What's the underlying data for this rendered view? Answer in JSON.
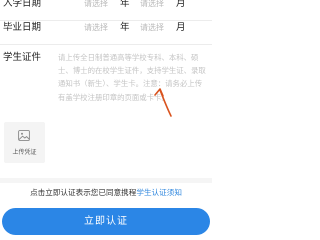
{
  "enroll_date": {
    "label": "入学日期",
    "year_placeholder": "请选择",
    "year_unit": "年",
    "month_placeholder": "请选择",
    "month_unit": "月"
  },
  "grad_date": {
    "label": "毕业日期",
    "year_placeholder": "请选择",
    "year_unit": "年",
    "month_placeholder": "请选择",
    "month_unit": "月"
  },
  "certificate": {
    "label": "学生证件",
    "hint": "请上传全日制普通高等学校专科、本科、硕士、博士的在校学生证件，支持学生证、录取通知书（新生）、学生卡。注意：请务必上传有盖学校注册印章的页面或卡卡。"
  },
  "upload": {
    "label": "上传凭证",
    "icon": "image-icon"
  },
  "consent": {
    "prefix": "点击立即认证表示您已同意携程",
    "link": "学生认证须知"
  },
  "submit": {
    "label": "立即认证"
  },
  "colors": {
    "accent": "#2b86e6",
    "annotation_arrow": "#d9531e",
    "placeholder": "#b9b9b9"
  }
}
